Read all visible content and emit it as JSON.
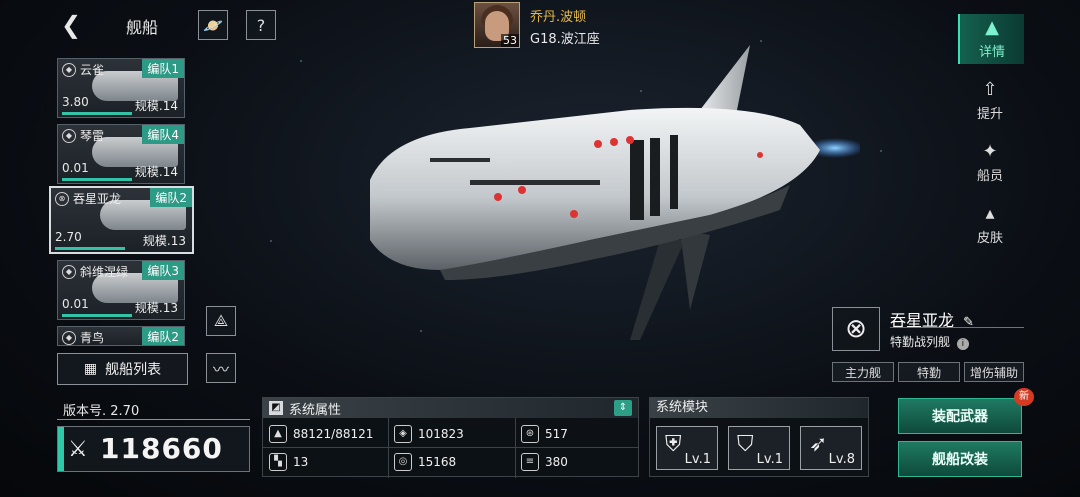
{
  "header": {
    "title": "舰船",
    "commander_name": "乔丹.波顿",
    "commander_level": "53",
    "location": "G18.波江座"
  },
  "ship_list": [
    {
      "name": "云雀",
      "fleet": "编队1",
      "version": "3.80",
      "scale": "规模.14",
      "selected": false
    },
    {
      "name": "琴雷",
      "fleet": "编队4",
      "version": "0.01",
      "scale": "规模.14",
      "selected": false
    },
    {
      "name": "吞星亚龙",
      "fleet": "编队2",
      "version": "2.70",
      "scale": "规模.13",
      "selected": true
    },
    {
      "name": "斜维涅绿",
      "fleet": "编队3",
      "version": "0.01",
      "scale": "规模.13",
      "selected": false
    },
    {
      "name": "青鸟",
      "fleet": "编队2",
      "version": "",
      "scale": "",
      "selected": false
    }
  ],
  "ship_list_button": "舰船列表",
  "right_tabs": [
    {
      "label": "详情",
      "active": true
    },
    {
      "label": "提升",
      "active": false
    },
    {
      "label": "船员",
      "active": false
    },
    {
      "label": "皮肤",
      "active": false
    }
  ],
  "ship": {
    "name": "吞星亚龙",
    "class": "特勤战列舰",
    "roles": [
      "主力舰",
      "特勤",
      "增伤辅助"
    ],
    "version_label": "版本号. 2.70",
    "power": "118660"
  },
  "attributes": {
    "title": "系统属性",
    "items": [
      {
        "icon": "hull-icon",
        "value": "88121/88121"
      },
      {
        "icon": "armor-icon",
        "value": "101823"
      },
      {
        "icon": "shield-icon",
        "value": "517"
      },
      {
        "icon": "grid-icon",
        "value": "13"
      },
      {
        "icon": "target-icon",
        "value": "15168"
      },
      {
        "icon": "speed-icon",
        "value": "380"
      }
    ]
  },
  "modules": {
    "title": "系统模块",
    "items": [
      {
        "icon": "shield-module-icon",
        "level": "Lv.1"
      },
      {
        "icon": "broken-shield-module-icon",
        "level": "Lv.1"
      },
      {
        "icon": "missile-module-icon",
        "level": "Lv.8"
      }
    ]
  },
  "actions": {
    "equip_weapons": "装配武器",
    "ship_modify": "舰船改装",
    "new_badge": "新"
  }
}
